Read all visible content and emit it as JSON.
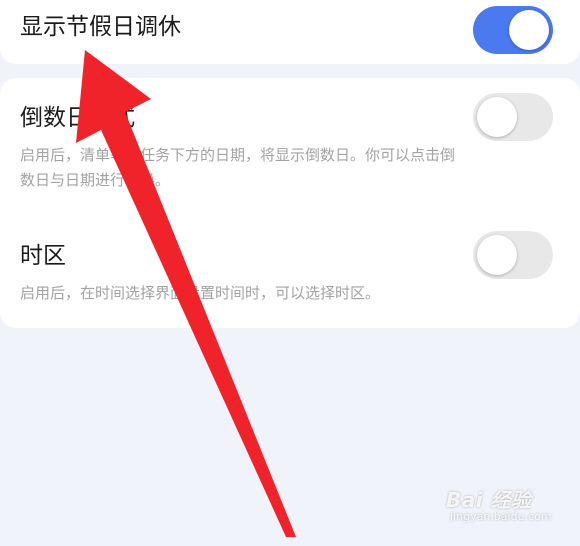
{
  "settings": {
    "holiday_adjust": {
      "title": "显示节假日调休",
      "enabled": true
    },
    "countdown_mode": {
      "title": "倒数日模式",
      "description": "启用后，清单等各任务下方的日期，将显示倒数日。你可以点击倒数日与日期进行切换。",
      "enabled": false
    },
    "timezone": {
      "title": "时区",
      "description": "启用后，在时间选择界面设置时间时，可以选择时区。",
      "enabled": false
    }
  },
  "colors": {
    "toggle_on": "#4a79f0",
    "toggle_off": "#e8e8e8",
    "annotation_arrow": "#f0232b",
    "page_background": "#f1f3fb"
  },
  "annotation": {
    "type": "red-arrow",
    "points_to": "settings.holiday_adjust.title"
  },
  "watermark": {
    "logo": "Bai 经验",
    "url": "jingyan.baidu.com"
  }
}
